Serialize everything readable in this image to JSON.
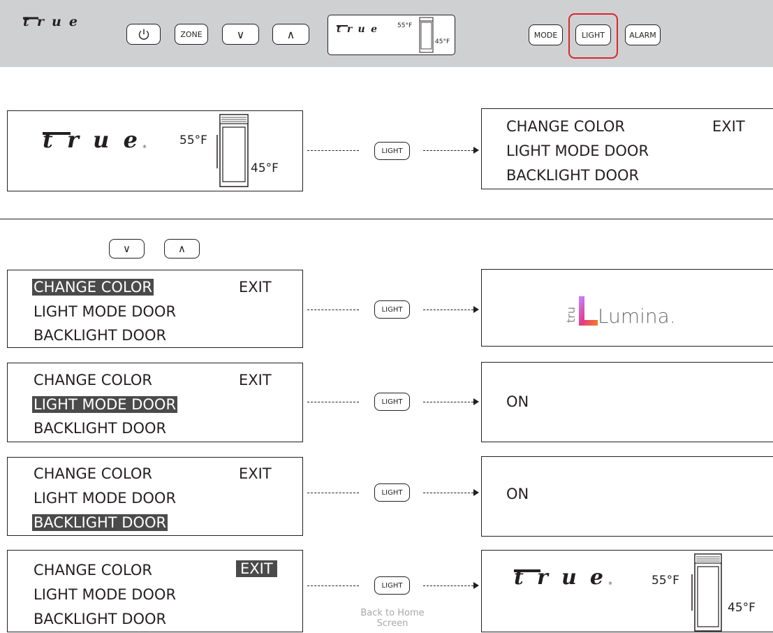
{
  "brand": {
    "logo_text": "true",
    "registered": "®"
  },
  "topbar": {
    "buttons": {
      "power_label": "",
      "zone_label": "ZONE",
      "down_label": "∨",
      "up_label": "∧",
      "mode_label": "MODE",
      "light_label": "LIGHT",
      "alarm_label": "ALARM"
    },
    "display": {
      "upper_temp": "55°F",
      "lower_temp": "45°F"
    },
    "highlighted_button": "LIGHT",
    "highlight_color": "#d9272e"
  },
  "home_screen": {
    "upper_temp": "55°F",
    "lower_temp": "45°F"
  },
  "menu": {
    "items": [
      "CHANGE COLOR",
      "LIGHT MODE DOOR",
      "BACKLIGHT DOOR"
    ],
    "exit_label": "EXIT"
  },
  "flow": {
    "button_label": "LIGHT",
    "nav_down": "∨",
    "nav_up": "∧",
    "results": {
      "change_color": {
        "logo_prefix": "tru",
        "logo_text": "Lumina."
      },
      "light_mode_door": "ON",
      "backlight_door": "ON",
      "exit": {
        "upper_temp": "55°F",
        "lower_temp": "45°F"
      }
    },
    "exit_note": "Back to Home Screen"
  },
  "colors": {
    "bar_bg": "#cfd0d2",
    "highlight_bg": "#4a4a4a",
    "accent_red": "#d9272e"
  }
}
